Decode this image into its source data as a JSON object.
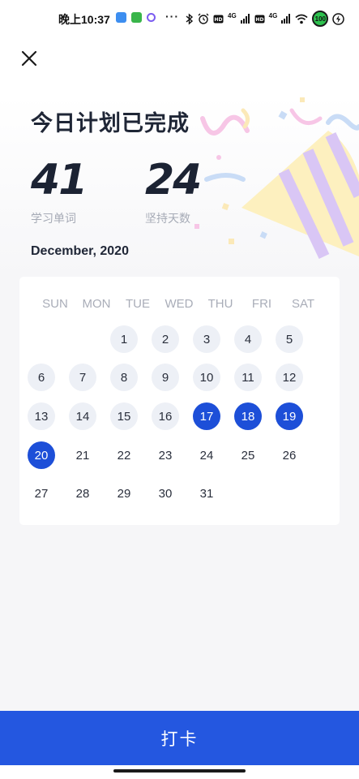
{
  "status_bar": {
    "time": "晚上10:37",
    "dots": "···",
    "network_1": "4G",
    "network_2": "4G",
    "battery": "100",
    "app_icon_colors": [
      "#3d8ef0",
      "#39b54a",
      "#7b5cf0"
    ]
  },
  "header": {
    "close_icon": "close-icon"
  },
  "hero": {
    "title": "今日计划已完成",
    "stats": [
      {
        "value": "41",
        "label": "学习单词"
      },
      {
        "value": "24",
        "label": "坚持天数"
      }
    ],
    "decoration_icon": "party-popper-icon"
  },
  "calendar": {
    "month_label": "December, 2020",
    "weekdays": [
      "SUN",
      "MON",
      "TUE",
      "WED",
      "THU",
      "FRI",
      "SAT"
    ],
    "first_weekday_index": 2,
    "days": [
      {
        "day": "1",
        "state": "checked"
      },
      {
        "day": "2",
        "state": "checked"
      },
      {
        "day": "3",
        "state": "checked"
      },
      {
        "day": "4",
        "state": "checked"
      },
      {
        "day": "5",
        "state": "checked"
      },
      {
        "day": "6",
        "state": "checked"
      },
      {
        "day": "7",
        "state": "checked"
      },
      {
        "day": "8",
        "state": "checked"
      },
      {
        "day": "9",
        "state": "checked"
      },
      {
        "day": "10",
        "state": "checked"
      },
      {
        "day": "11",
        "state": "checked"
      },
      {
        "day": "12",
        "state": "checked"
      },
      {
        "day": "13",
        "state": "checked"
      },
      {
        "day": "14",
        "state": "checked"
      },
      {
        "day": "15",
        "state": "checked"
      },
      {
        "day": "16",
        "state": "checked"
      },
      {
        "day": "17",
        "state": "done"
      },
      {
        "day": "18",
        "state": "done"
      },
      {
        "day": "19",
        "state": "done"
      },
      {
        "day": "20",
        "state": "done"
      },
      {
        "day": "21",
        "state": "none"
      },
      {
        "day": "22",
        "state": "none"
      },
      {
        "day": "23",
        "state": "none"
      },
      {
        "day": "24",
        "state": "none"
      },
      {
        "day": "25",
        "state": "none"
      },
      {
        "day": "26",
        "state": "none"
      },
      {
        "day": "27",
        "state": "none"
      },
      {
        "day": "28",
        "state": "none"
      },
      {
        "day": "29",
        "state": "none"
      },
      {
        "day": "30",
        "state": "none"
      },
      {
        "day": "31",
        "state": "none"
      }
    ]
  },
  "action": {
    "checkin_label": "打卡"
  },
  "colors": {
    "accent": "#1d4fd8",
    "button": "#2457e0",
    "checked_bg": "#edf0f6"
  }
}
